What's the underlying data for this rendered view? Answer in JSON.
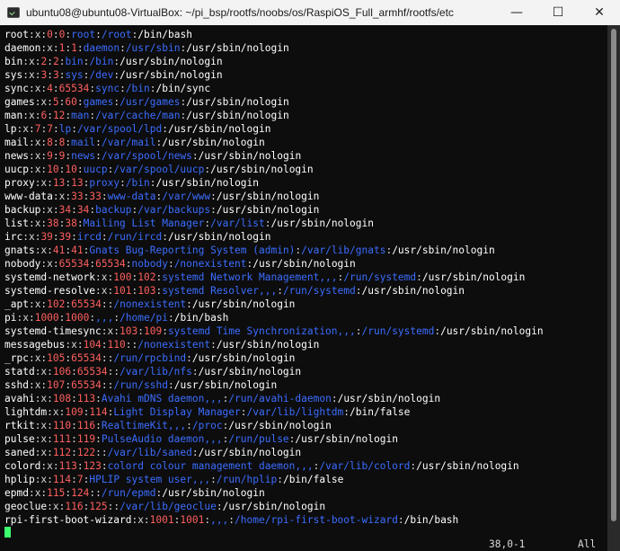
{
  "window": {
    "title": "ubuntu08@ubuntu08-VirtualBox: ~/pi_bsp/rootfs/noobs/os/RaspiOS_Full_armhf/rootfs/etc",
    "minimize_icon": "minimize-icon",
    "maximize_icon": "maximize-icon",
    "close_icon": "close-icon"
  },
  "colors": {
    "title_bar": "#f3f3f3",
    "terminal_bg": "#0d0d0d",
    "field_text": "#ffffff",
    "separator": "#d8d8d8",
    "uid_gid": "#ff5f5f",
    "path": "#3b6dff",
    "cursor": "#3dff6e"
  },
  "terminal": {
    "lines": [
      [
        "root",
        "0",
        "0",
        "root",
        "/root",
        "/bin/bash"
      ],
      [
        "daemon",
        "1",
        "1",
        "daemon",
        "/usr/sbin",
        "/usr/sbin/nologin"
      ],
      [
        "bin",
        "2",
        "2",
        "bin",
        "/bin",
        "/usr/sbin/nologin"
      ],
      [
        "sys",
        "3",
        "3",
        "sys",
        "/dev",
        "/usr/sbin/nologin"
      ],
      [
        "sync",
        "4",
        "65534",
        "sync",
        "/bin",
        "/bin/sync"
      ],
      [
        "games",
        "5",
        "60",
        "games",
        "/usr/games",
        "/usr/sbin/nologin"
      ],
      [
        "man",
        "6",
        "12",
        "man",
        "/var/cache/man",
        "/usr/sbin/nologin"
      ],
      [
        "lp",
        "7",
        "7",
        "lp",
        "/var/spool/lpd",
        "/usr/sbin/nologin"
      ],
      [
        "mail",
        "8",
        "8",
        "mail",
        "/var/mail",
        "/usr/sbin/nologin"
      ],
      [
        "news",
        "9",
        "9",
        "news",
        "/var/spool/news",
        "/usr/sbin/nologin"
      ],
      [
        "uucp",
        "10",
        "10",
        "uucp",
        "/var/spool/uucp",
        "/usr/sbin/nologin"
      ],
      [
        "proxy",
        "13",
        "13",
        "proxy",
        "/bin",
        "/usr/sbin/nologin"
      ],
      [
        "www-data",
        "33",
        "33",
        "www-data",
        "/var/www",
        "/usr/sbin/nologin"
      ],
      [
        "backup",
        "34",
        "34",
        "backup",
        "/var/backups",
        "/usr/sbin/nologin"
      ],
      [
        "list",
        "38",
        "38",
        "Mailing List Manager",
        "/var/list",
        "/usr/sbin/nologin"
      ],
      [
        "irc",
        "39",
        "39",
        "ircd",
        "/run/ircd",
        "/usr/sbin/nologin"
      ],
      [
        "gnats",
        "41",
        "41",
        "Gnats Bug-Reporting System (admin)",
        "/var/lib/gnats",
        "/usr/sbin/nologin"
      ],
      [
        "nobody",
        "65534",
        "65534",
        "nobody",
        "/nonexistent",
        "/usr/sbin/nologin"
      ],
      [
        "systemd-network",
        "100",
        "102",
        "systemd Network Management,,,",
        "/run/systemd",
        "/usr/sbin/nologin"
      ],
      [
        "systemd-resolve",
        "101",
        "103",
        "systemd Resolver,,,",
        "/run/systemd",
        "/usr/sbin/nologin"
      ],
      [
        "_apt",
        "102",
        "65534",
        "",
        "/nonexistent",
        "/usr/sbin/nologin"
      ],
      [
        "pi",
        "1000",
        "1000",
        ",,,",
        "/home/pi",
        "/bin/bash"
      ],
      [
        "systemd-timesync",
        "103",
        "109",
        "systemd Time Synchronization,,,",
        "/run/systemd",
        "/usr/sbin/nologin"
      ],
      [
        "messagebus",
        "104",
        "110",
        "",
        "/nonexistent",
        "/usr/sbin/nologin"
      ],
      [
        "_rpc",
        "105",
        "65534",
        "",
        "/run/rpcbind",
        "/usr/sbin/nologin"
      ],
      [
        "statd",
        "106",
        "65534",
        "",
        "/var/lib/nfs",
        "/usr/sbin/nologin"
      ],
      [
        "sshd",
        "107",
        "65534",
        "",
        "/run/sshd",
        "/usr/sbin/nologin"
      ],
      [
        "avahi",
        "108",
        "113",
        "Avahi mDNS daemon,,,",
        "/run/avahi-daemon",
        "/usr/sbin/nologin"
      ],
      [
        "lightdm",
        "109",
        "114",
        "Light Display Manager",
        "/var/lib/lightdm",
        "/bin/false"
      ],
      [
        "rtkit",
        "110",
        "116",
        "RealtimeKit,,,",
        "/proc",
        "/usr/sbin/nologin"
      ],
      [
        "pulse",
        "111",
        "119",
        "PulseAudio daemon,,,",
        "/run/pulse",
        "/usr/sbin/nologin"
      ],
      [
        "saned",
        "112",
        "122",
        "",
        "/var/lib/saned",
        "/usr/sbin/nologin"
      ],
      [
        "colord",
        "113",
        "123",
        "colord colour management daemon,,,",
        "/var/lib/colord",
        "/usr/sbin/nologin"
      ],
      [
        "hplip",
        "114",
        "7",
        "HPLIP system user,,,",
        "/run/hplip",
        "/bin/false"
      ],
      [
        "epmd",
        "115",
        "124",
        "",
        "/run/epmd",
        "/usr/sbin/nologin"
      ],
      [
        "geoclue",
        "116",
        "125",
        "",
        "/var/lib/geoclue",
        "/usr/sbin/nologin"
      ],
      [
        "rpi-first-boot-wizard",
        "1001",
        "1001",
        ",,,",
        "/home/rpi-first-boot-wizard",
        "/bin/bash"
      ]
    ]
  },
  "status": {
    "position": "38,0-1",
    "percent": "All"
  }
}
